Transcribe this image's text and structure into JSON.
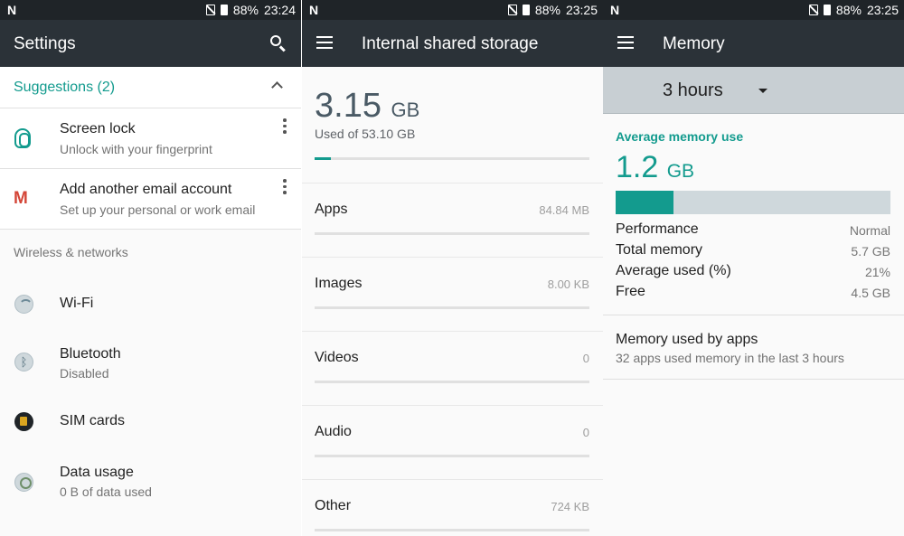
{
  "status": [
    {
      "carrier": "N",
      "battery": "88%",
      "time": "23:24"
    },
    {
      "carrier": "N",
      "battery": "88%",
      "time": "23:25"
    },
    {
      "carrier": "N",
      "battery": "88%",
      "time": "23:25"
    }
  ],
  "settings": {
    "title": "Settings",
    "suggestions_label": "Suggestions (2)",
    "suggestions": [
      {
        "title": "Screen lock",
        "subtitle": "Unlock with your fingerprint",
        "icon": "fingerprint-icon"
      },
      {
        "title": "Add another email account",
        "subtitle": "Set up your personal or work email",
        "icon": "gmail-icon"
      }
    ],
    "section": "Wireless & networks",
    "items": [
      {
        "title": "Wi-Fi",
        "subtitle": "",
        "icon": "wifi-icon"
      },
      {
        "title": "Bluetooth",
        "subtitle": "Disabled",
        "icon": "bluetooth-icon"
      },
      {
        "title": "SIM cards",
        "subtitle": "",
        "icon": "sim-card-icon"
      },
      {
        "title": "Data usage",
        "subtitle": "0 B of data used",
        "icon": "data-usage-icon"
      }
    ]
  },
  "storage": {
    "title": "Internal shared storage",
    "used_value": "3.15",
    "used_unit": "GB",
    "used_of": "Used of 53.10 GB",
    "used_fraction": 0.06,
    "items": [
      {
        "name": "Apps",
        "size": "84.84 MB",
        "fraction": 0
      },
      {
        "name": "Images",
        "size": "8.00 KB",
        "fraction": 0
      },
      {
        "name": "Videos",
        "size": "0",
        "fraction": 0
      },
      {
        "name": "Audio",
        "size": "0",
        "fraction": 0
      },
      {
        "name": "Other",
        "size": "724 KB",
        "fraction": 0
      }
    ]
  },
  "memory": {
    "title": "Memory",
    "period": "3 hours",
    "avg_label": "Average memory use",
    "avg_value": "1.2",
    "avg_unit": "GB",
    "avg_fraction": 0.21,
    "stats": [
      {
        "key": "Performance",
        "value": "Normal"
      },
      {
        "key": "Total memory",
        "value": "5.7 GB"
      },
      {
        "key": "Average used (%)",
        "value": "21%"
      },
      {
        "key": "Free",
        "value": "4.5 GB"
      }
    ],
    "apps_title": "Memory used by apps",
    "apps_subtitle": "32 apps used memory in the last 3 hours"
  },
  "colors": {
    "accent": "#139b8e",
    "appbar": "#2b3238",
    "statusbar": "#1f2428"
  }
}
